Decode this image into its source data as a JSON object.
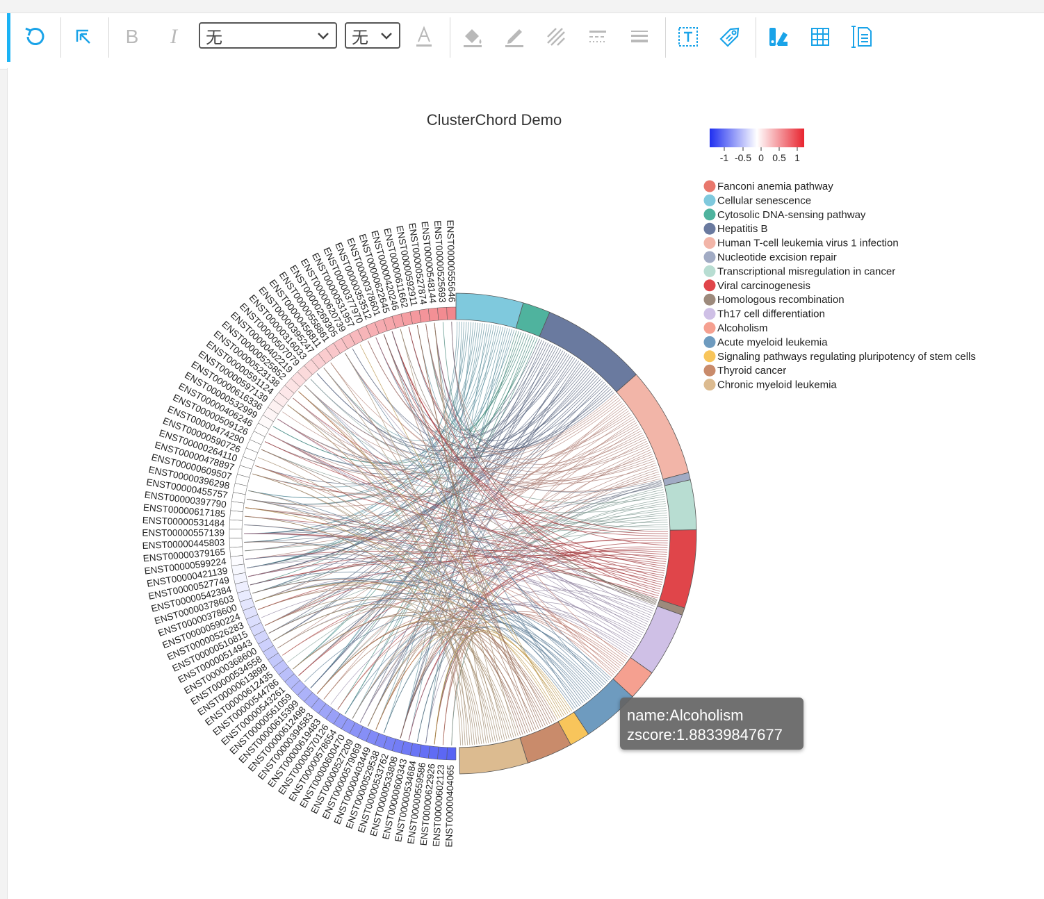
{
  "toolbar": {
    "font_select": "无",
    "size_select": "无"
  },
  "chart_data": {
    "type": "chord",
    "title": "ClusterChord Demo",
    "colorbar": {
      "ticks": [
        "-1",
        "-0.5",
        "0",
        "0.5",
        "1"
      ],
      "min_color": "#1f2ff0",
      "mid_color": "#ffffff",
      "max_color": "#e8242f"
    },
    "pathways": [
      {
        "name": "Fanconi anemia pathway",
        "color": "#e8776c",
        "share": 0.0
      },
      {
        "name": "Cellular senescence",
        "color": "#7fc9dd",
        "share": 0.073
      },
      {
        "name": "Cytosolic DNA-sensing pathway",
        "color": "#4fb39e",
        "share": 0.03
      },
      {
        "name": "Hepatitis B",
        "color": "#6a7a9f",
        "share": 0.115
      },
      {
        "name": "Human T-cell leukemia virus 1 infection",
        "color": "#f2b5a8",
        "share": 0.12
      },
      {
        "name": "Nucleotide excision repair",
        "color": "#a1abc4",
        "share": 0.008
      },
      {
        "name": "Transcriptional misregulation in cancer",
        "color": "#b8ddd2",
        "share": 0.054
      },
      {
        "name": "Viral carcinogenesis",
        "color": "#e0454a",
        "share": 0.085
      },
      {
        "name": "Homologous recombination",
        "color": "#9d8a7c",
        "share": 0.008
      },
      {
        "name": "Th17 cell differentiation",
        "color": "#cfc0e6",
        "share": 0.07
      },
      {
        "name": "Alcoholism",
        "color": "#f5a090",
        "share": 0.033
      },
      {
        "name": "Acute myeloid leukemia",
        "color": "#6e9bbf",
        "share": 0.062
      },
      {
        "name": "Signaling pathways regulating pluripotency of stem cells",
        "color": "#f8c55b",
        "share": 0.022
      },
      {
        "name": "Thyroid cancer",
        "color": "#c98b6b",
        "share": 0.05
      },
      {
        "name": "Chronic myeloid leukemia",
        "color": "#dcbb90",
        "share": 0.074
      }
    ],
    "genes": [
      "ENST00000404065",
      "ENST00000602123",
      "ENST00000622926",
      "ENST00000559586",
      "ENST00000534684",
      "ENST00000600343",
      "ENST00000533808",
      "ENST00000533762",
      "ENST00000529538",
      "ENST00000403449",
      "ENST00000579069",
      "ENST00000527209",
      "ENST00000600470",
      "ENST00000578654",
      "ENST00000570126",
      "ENST00000619483",
      "ENST00000394583",
      "ENST00000612498",
      "ENST00000615399",
      "ENST00000561059",
      "ENST00000543261",
      "ENST00000544786",
      "ENST00000612435",
      "ENST00000613898",
      "ENST00000534558",
      "ENST00000368600",
      "ENST00000514943",
      "ENST00000510815",
      "ENST00000526283",
      "ENST00000590224",
      "ENST00000378600",
      "ENST00000378603",
      "ENST00000542384",
      "ENST00000527749",
      "ENST00000421139",
      "ENST00000599224",
      "ENST00000379165",
      "ENST00000445803",
      "ENST00000557139",
      "ENST00000531484",
      "ENST00000617185",
      "ENST00000397790",
      "ENST00000455757",
      "ENST00000396298",
      "ENST00000609507",
      "ENST00000478897",
      "ENST00000264110",
      "ENST00000590726",
      "ENST00000474290",
      "ENST00000509126",
      "ENST00000406246",
      "ENST00000532999",
      "ENST00000616336",
      "ENST00000597139",
      "ENST00000591124",
      "ENST00000523138",
      "ENST00000525852",
      "ENST00000402219",
      "ENST00000507079",
      "ENST00000316033",
      "ENST00000395247",
      "ENST00000456811",
      "ENST00000558861",
      "ENST00000269305",
      "ENST00000620739",
      "ENST00000531957",
      "ENST00000377970",
      "ENST00000353512",
      "ENST00000378601",
      "ENST00000622645",
      "ENST00000420246",
      "ENST00000611662",
      "ENST00000592911",
      "ENST00000527874",
      "ENST00000548144",
      "ENST00000525693",
      "ENST00000555646"
    ],
    "tooltip": {
      "name_line": "name:Alcoholism",
      "zscore_line": "zscore:1.88339847677"
    }
  }
}
